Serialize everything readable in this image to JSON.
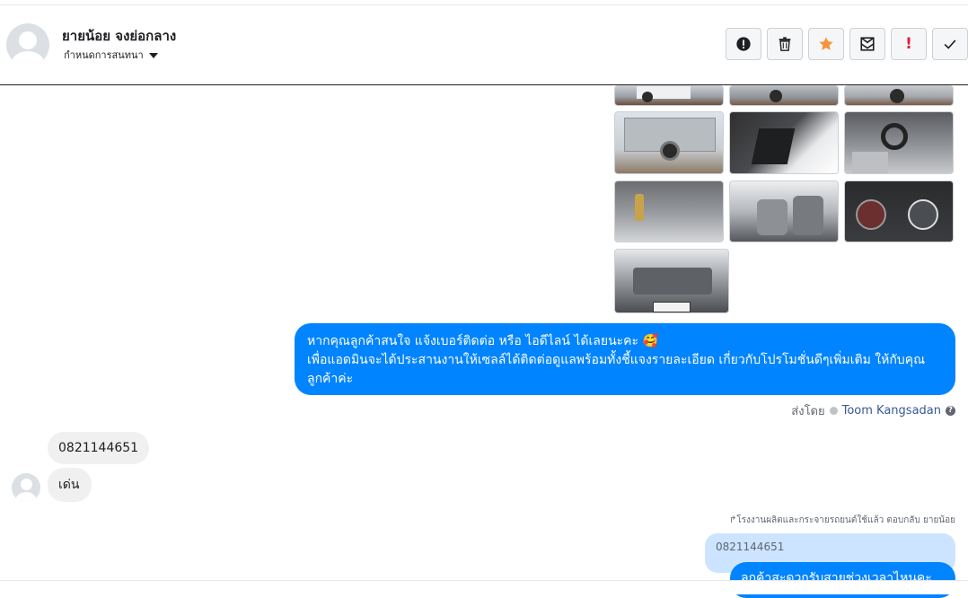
{
  "conversation": {
    "contact_name": "ยายน้อย จงย่อกลาง",
    "label_selector": "กำหนดการสนทนา"
  },
  "toolbar": {
    "icons": [
      "info-circle-icon",
      "trash-icon",
      "star-icon",
      "mark-unread-icon",
      "important-icon",
      "check-icon"
    ],
    "important_glyph": "!",
    "star_color": "#f7923b",
    "important_color": "#e41e3f"
  },
  "messages": {
    "outgoing_line1": "หากคุณลูกค้าสนใจ แจ้งเบอร์ติดต่อ หรือ ไอดีไลน์ ได้เลยนะคะ 🥰",
    "outgoing_line2": "เพื่อแอดมินจะได้ประสานงานให้เซลล์ได้ติดต่อดูแลพร้อมทั้งชี้แจงรายละเอียด เกี่ยวกับโปรโมชั่นดีๆเพิ่มเติม ให้กับคุณลูกค้าค่ะ",
    "sent_by_label": "ส่งโดย",
    "sent_by_name": "Toom Kangsadan",
    "incoming_phone": "0821144651",
    "incoming_word": "เด่น",
    "reply_context": "↱โรงงานผลิตและกระจายรถยนต์ใช้แล้ว ตอบกลับ ยายน้อย",
    "quoted_text": "0821144651",
    "outgoing_reply": "ลูกค้าสะดวกรับสายช่วงเวลาไหนคะ"
  },
  "colors": {
    "messenger_blue": "#0084ff",
    "incoming_gray": "#f1f0f0",
    "quoted_blue": "#cce4ff"
  }
}
